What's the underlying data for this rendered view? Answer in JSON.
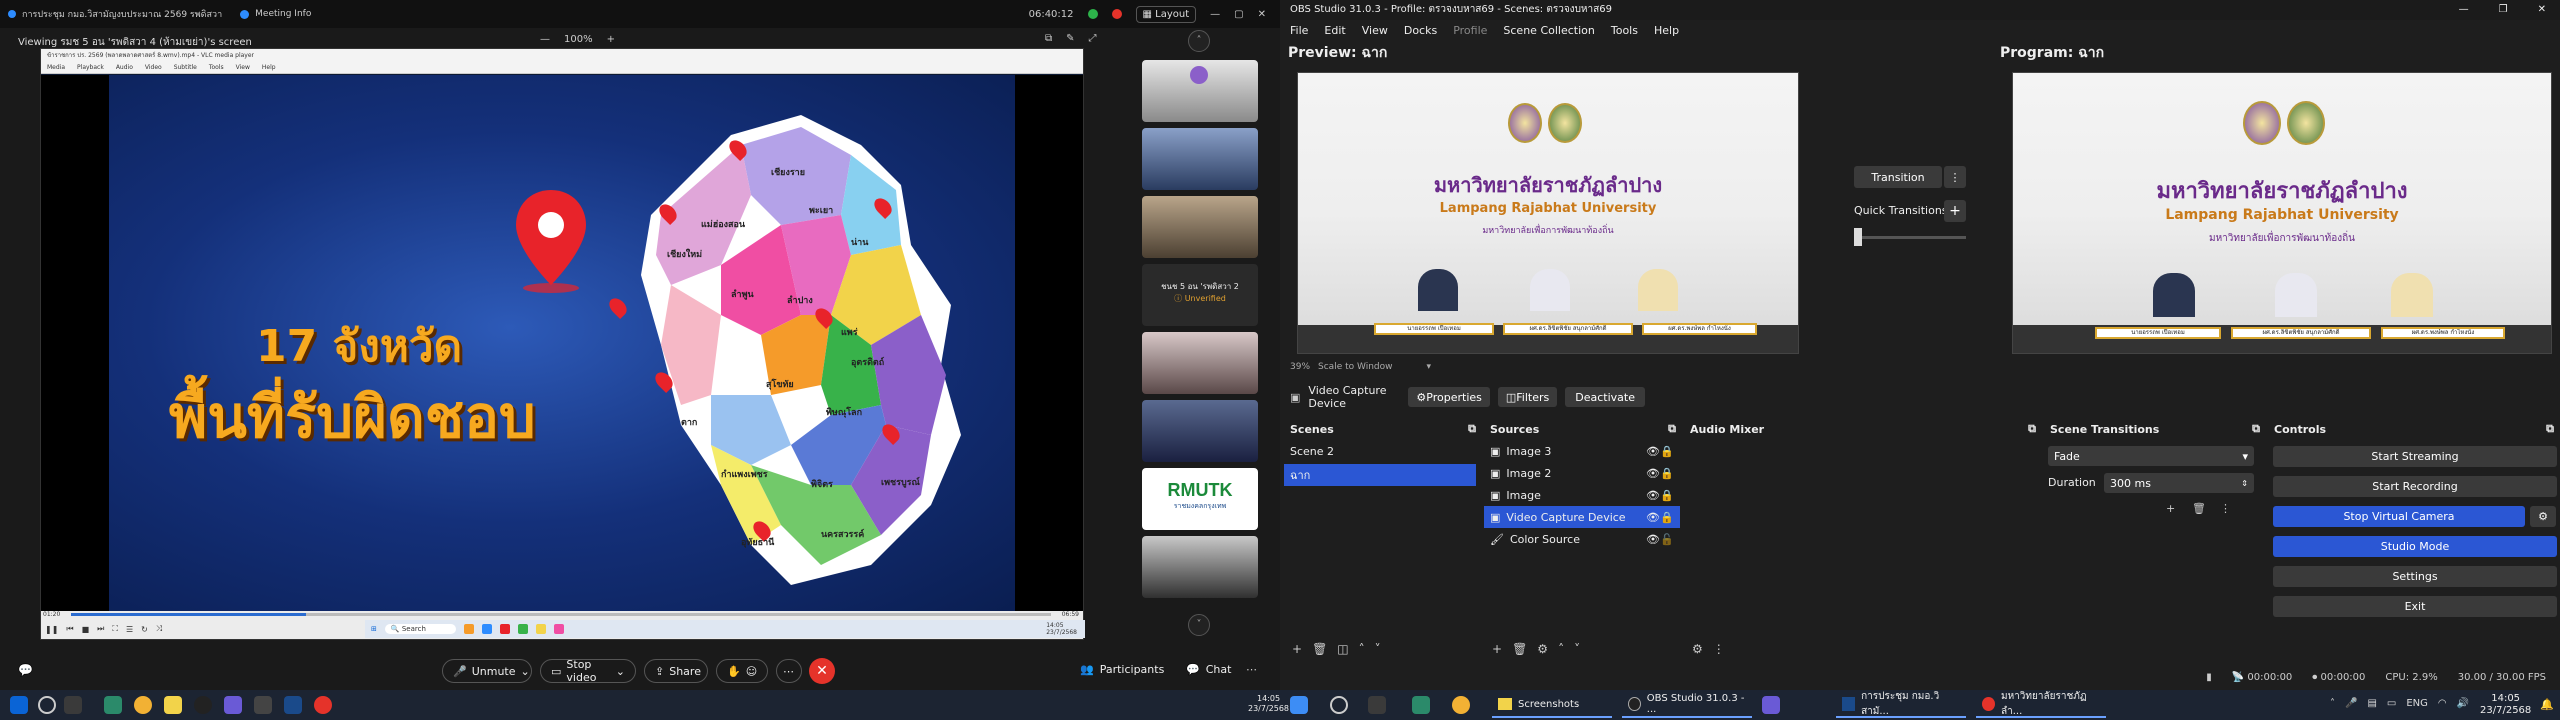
{
  "zoom": {
    "title_left": "การประชุม กมอ.วิสามัญงบประมาณ 2569 รพดิสวา",
    "meeting_info": "Meeting Info",
    "timer": "06:40:12",
    "layout": "Layout",
    "viewing": "Viewing รมช 5 อน 'รพดิสวา 4 (ห้ามเขย่า)'s screen",
    "zoom_level": "100%",
    "vlc_title": "ข้าราชการ ปร. 2569 (พลาดพลาดศาสตร์ 8.wmv).mp4 - VLC media player",
    "vlc_menu": [
      "Media",
      "Playback",
      "Audio",
      "Video",
      "Subtitle",
      "Tools",
      "View",
      "Help"
    ],
    "slide_line1": "17 จังหวัด",
    "slide_line2": "พื้นที่รับผิดชอบ",
    "provinces": [
      "แม่ฮ่องสอน",
      "เชียงราย",
      "เชียงใหม่",
      "พะเยา",
      "น่าน",
      "ลำพูน",
      "ลำปาง",
      "แพร่",
      "อุตรดิตถ์",
      "ตาก",
      "สุโขทัย",
      "พิษณุโลก",
      "กำแพงเพชร",
      "พิจิตร",
      "เพชรบูรณ์",
      "อุทัยธานี",
      "นครสวรรค์"
    ],
    "vlc_time_left": "01:20",
    "vlc_time_right": "06:59",
    "vlc_progress": 0.24,
    "win_search": "Search",
    "win_clock": "14:05\n23/7/2568",
    "thumb_label": "ชนช 5 อน 'รพดิสวา 2",
    "thumb_unverified": "Unverified",
    "thumb_logo": "RMUTK",
    "thumb_logo_sub": "ราชมงคลกรุงเทพ",
    "unmute": "Unmute",
    "stop_video": "Stop video",
    "share": "Share",
    "participants": "Participants",
    "chat": "Chat"
  },
  "obs": {
    "title": "OBS Studio 31.0.3 - Profile: ตรวจงบหาส69 - Scenes: ตรวจงบหาส69",
    "menu": [
      "File",
      "Edit",
      "View",
      "Docks",
      "Profile",
      "Scene Collection",
      "Tools",
      "Help"
    ],
    "preview_label": "Preview: ฉาก",
    "program_label": "Program: ฉาก",
    "university_th": "มหาวิทยาลัยราชภัฏลำปาง",
    "university_en": "Lampang Rajabhat University",
    "university_motto": "มหาวิทยาลัยเพื่อการพัฒนาท้องถิ่น",
    "nameplates": [
      "นายอรรถพ เปื้อเทอม",
      "ผศ.ดร.ลิขิตพิชัย สนุกลาม์ศักดิ์",
      "ผศ.ดร.พงษ์พล กำไหงนั่ง"
    ],
    "transition_btn": "Transition",
    "quick_transitions": "Quick Transitions",
    "zoom_pct": "39%",
    "scale_label": "Scale to Window",
    "source_name": "Video Capture Device",
    "properties": "Properties",
    "filters": "Filters",
    "deactivate": "Deactivate",
    "docks": {
      "scenes": "Scenes",
      "sources": "Sources",
      "audio": "Audio Mixer",
      "transitions": "Scene Transitions",
      "controls": "Controls"
    },
    "scenes": [
      "Scene 2",
      "ฉาก"
    ],
    "sources": [
      "Image 3",
      "Image 2",
      "Image",
      "Video Capture Device",
      "Color Source"
    ],
    "transition_type": "Fade",
    "duration_label": "Duration",
    "duration_value": "300 ms",
    "controls": [
      "Start Streaming",
      "Start Recording",
      "Stop Virtual Camera",
      "Studio Mode",
      "Settings",
      "Exit"
    ],
    "status_time1": "00:00:00",
    "status_time2": "00:00:00",
    "cpu": "CPU: 2.9%",
    "fps": "30.00 / 30.00 FPS"
  },
  "taskbar": {
    "apps": [
      "Screenshots",
      "OBS Studio 31.0.3 - ...",
      "การประชุม กมอ.วิสามั...",
      "มหาวิทยาลัยราชภัฏลำ..."
    ],
    "lang": "ENG",
    "time": "14:05",
    "date": "23/7/2568"
  }
}
